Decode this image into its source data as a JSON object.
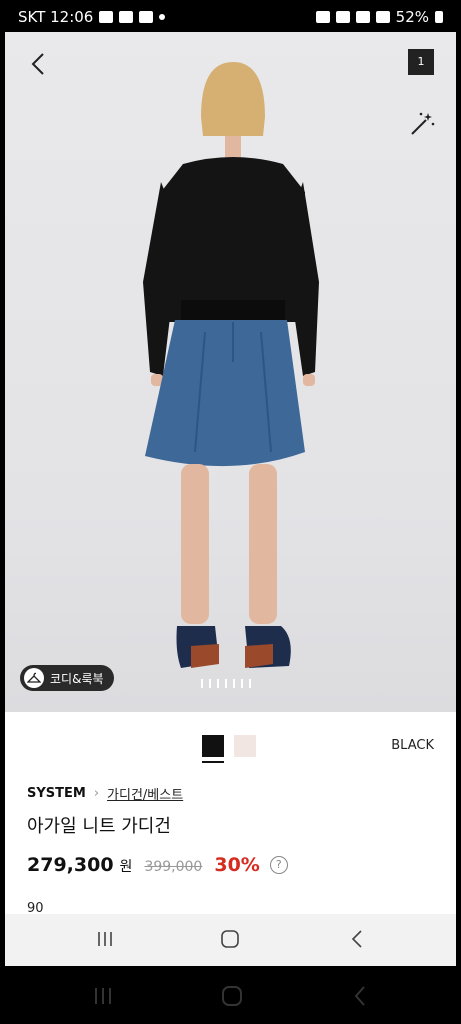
{
  "status_bar": {
    "left_text": "SKT 12:06",
    "battery_text": "52%"
  },
  "photo": {
    "image_count": "1",
    "codi_chip_label": "코디&룩북",
    "dot_count": 7
  },
  "colors": {
    "selected_label": "BLACK",
    "swatches": [
      {
        "name": "black",
        "hex": "#111111"
      },
      {
        "name": "cream",
        "hex": "#f2e6e3"
      }
    ]
  },
  "product": {
    "brand": "SYSTEM",
    "category": "가디건/베스트",
    "name": "아가일 니트 가디건",
    "price": "279,300",
    "currency": "원",
    "original_price": "399,000",
    "discount": "30%",
    "partial_line": "90"
  },
  "theme": {
    "discount_color": "#d62c1f"
  }
}
